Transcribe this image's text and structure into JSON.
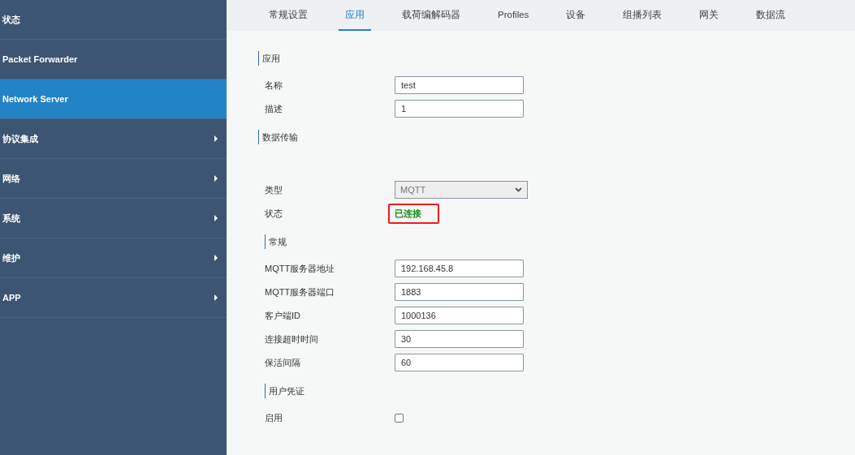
{
  "sidebar": {
    "items": [
      {
        "label": "状态",
        "selected": false,
        "has_submenu": false
      },
      {
        "label": "Packet Forwarder",
        "selected": false,
        "has_submenu": false
      },
      {
        "label": "Network Server",
        "selected": true,
        "has_submenu": false
      },
      {
        "label": "协议集成",
        "selected": false,
        "has_submenu": true
      },
      {
        "label": "网络",
        "selected": false,
        "has_submenu": true
      },
      {
        "label": "系统",
        "selected": false,
        "has_submenu": true
      },
      {
        "label": "维护",
        "selected": false,
        "has_submenu": true
      },
      {
        "label": "APP",
        "selected": false,
        "has_submenu": true
      }
    ]
  },
  "tabs": [
    {
      "label": "常规设置",
      "selected": false
    },
    {
      "label": "应用",
      "selected": true
    },
    {
      "label": "载荷编解码器",
      "selected": false
    },
    {
      "label": "Profiles",
      "selected": false
    },
    {
      "label": "设备",
      "selected": false
    },
    {
      "label": "组播列表",
      "selected": false
    },
    {
      "label": "网关",
      "selected": false
    },
    {
      "label": "数据流",
      "selected": false
    }
  ],
  "sections": [
    {
      "title": "应用",
      "rows": [
        {
          "kind": "input",
          "label": "名称",
          "value": "test"
        },
        {
          "kind": "input",
          "label": "描述",
          "value": "1"
        }
      ]
    },
    {
      "title": "数据传输",
      "rows": [
        {
          "kind": "select",
          "label": "类型",
          "value": "MQTT"
        },
        {
          "kind": "status",
          "label": "状态",
          "value": "已连接",
          "highlighted": true
        }
      ]
    },
    {
      "title": "常规",
      "rows": [
        {
          "kind": "input",
          "label": "MQTT服务器地址",
          "value": "192.168.45.8"
        },
        {
          "kind": "input",
          "label": "MQTT服务器端口",
          "value": "1883"
        },
        {
          "kind": "input",
          "label": "客户端ID",
          "value": "1000136"
        },
        {
          "kind": "input",
          "label": "连接超时时间",
          "value": "30"
        },
        {
          "kind": "input",
          "label": "保活间隔",
          "value": "60"
        }
      ]
    },
    {
      "title": "用户凭证",
      "rows": [
        {
          "kind": "checkbox",
          "label": "启用",
          "checked": false
        }
      ]
    }
  ]
}
